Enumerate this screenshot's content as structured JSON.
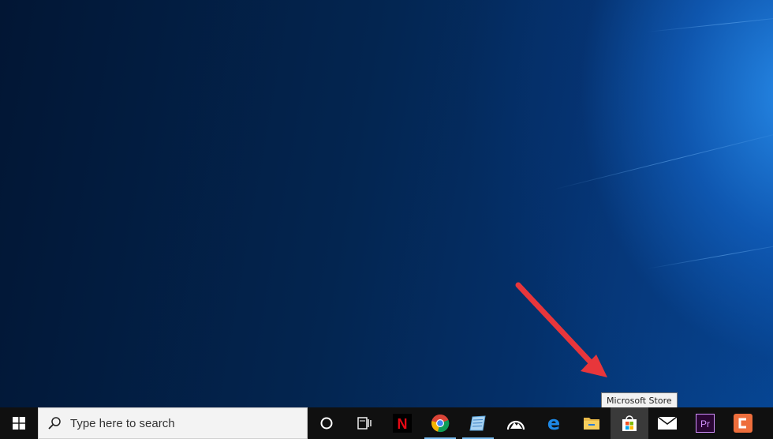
{
  "desktop": {
    "tooltip": "Microsoft Store",
    "arrow_color": "#e8363b"
  },
  "taskbar": {
    "start_icon": "windows-logo-icon",
    "search": {
      "placeholder": "Type here to search",
      "icon": "search-icon"
    },
    "cortana_icon": "cortana-circle-icon",
    "task_view_icon": "task-view-icon",
    "apps": [
      {
        "name": "Netflix",
        "icon": "netflix-icon",
        "label": "N",
        "running": false
      },
      {
        "name": "Google Chrome",
        "icon": "chrome-icon",
        "running": true
      },
      {
        "name": "Notepad",
        "icon": "notepad-icon",
        "running": true
      },
      {
        "name": "Photos",
        "icon": "photos-icon",
        "running": false
      },
      {
        "name": "Microsoft Edge",
        "icon": "edge-icon",
        "label": "e",
        "running": false
      },
      {
        "name": "File Explorer",
        "icon": "file-explorer-icon",
        "running": false
      },
      {
        "name": "Microsoft Store",
        "icon": "store-icon",
        "running": false,
        "hovered": true
      },
      {
        "name": "Mail",
        "icon": "mail-icon",
        "running": false
      },
      {
        "name": "Adobe Premiere",
        "icon": "premiere-icon",
        "label": "Pr",
        "running": false
      },
      {
        "name": "Camtasia",
        "icon": "camtasia-icon",
        "label": "C",
        "running": false
      }
    ]
  }
}
